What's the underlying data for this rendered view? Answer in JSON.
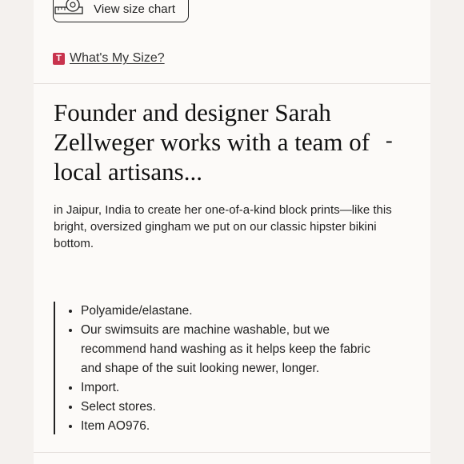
{
  "size_chart": {
    "label": "View size chart",
    "icon": "measuring-tape-icon"
  },
  "whats_my_size": {
    "badge": "T",
    "label": "What's My Size?",
    "badge_color": "#c8334d"
  },
  "description": {
    "heading": "Founder and designer Sarah Zellweger works with a team of local artisans...",
    "toggle": "-",
    "intro": "in Jaipur, India to create her one-of-a-kind block prints—like this bright, oversized gingham we put on our classic hipster bikini bottom."
  },
  "details": [
    "Polyamide/elastane.",
    "Our swimsuits are machine washable, but we recommend hand washing as it helps keep the fabric and shape of the suit looking newer, longer.",
    "Import.",
    "Select stores.",
    "Item AO976."
  ]
}
